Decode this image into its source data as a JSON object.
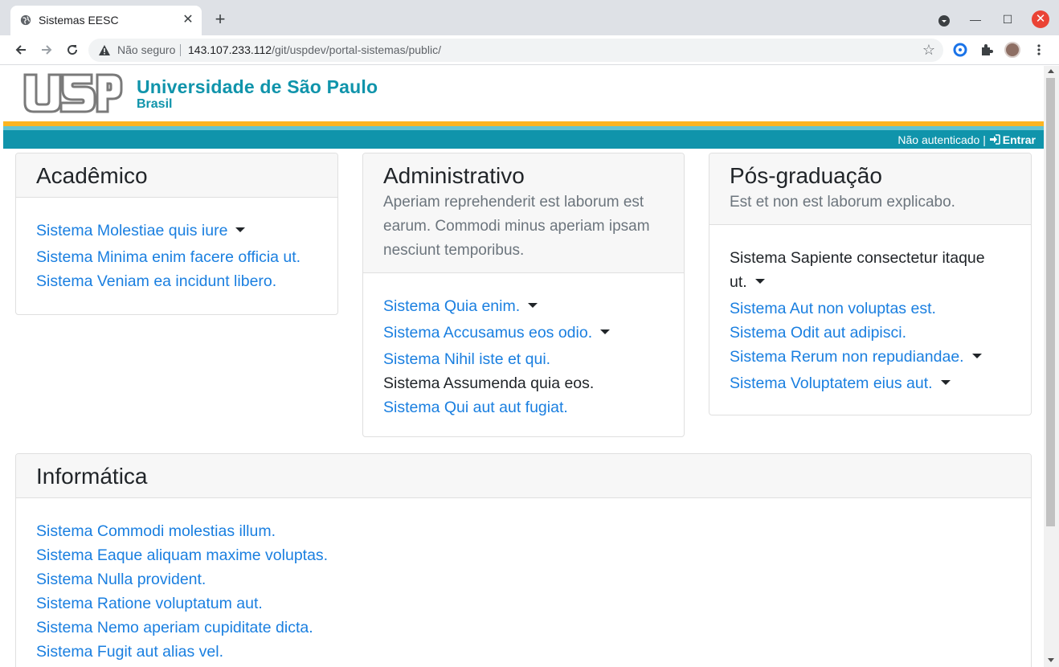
{
  "browser": {
    "tab_title": "Sistemas EESC",
    "insecure_label": "Não seguro",
    "url_host": "143.107.233.112",
    "url_path": "/git/uspdev/portal-sistemas/public/"
  },
  "header": {
    "logo_text": "USP",
    "university_name": "Universidade de São Paulo",
    "country": "Brasil",
    "auth_status": "Não autenticado |",
    "login_label": "Entrar"
  },
  "colors": {
    "brand": "#1094ab",
    "accent_yellow": "#fcb421",
    "link": "#1a7fe0"
  },
  "sections": [
    {
      "title": "Acadêmico",
      "subtitle": "",
      "items": [
        {
          "label": "Sistema Molestiae quis iure",
          "link": true,
          "dropdown": true
        },
        {
          "label": "Sistema Minima enim facere officia ut.",
          "link": true,
          "dropdown": false
        },
        {
          "label": "Sistema Veniam ea incidunt libero.",
          "link": true,
          "dropdown": false
        }
      ]
    },
    {
      "title": "Administrativo",
      "subtitle": "Aperiam reprehenderit est laborum est earum. Commodi minus aperiam ipsam nesciunt temporibus.",
      "items": [
        {
          "label": "Sistema Quia enim.",
          "link": true,
          "dropdown": true
        },
        {
          "label": "Sistema Accusamus eos odio.",
          "link": true,
          "dropdown": true
        },
        {
          "label": "Sistema Nihil iste et qui.",
          "link": true,
          "dropdown": false
        },
        {
          "label": "Sistema Assumenda quia eos.",
          "link": false,
          "dropdown": false
        },
        {
          "label": "Sistema Qui aut aut fugiat.",
          "link": true,
          "dropdown": false
        }
      ]
    },
    {
      "title": "Pós-graduação",
      "subtitle": "Est et non est laborum explicabo.",
      "items": [
        {
          "label": "Sistema Sapiente consectetur itaque ut.",
          "link": false,
          "dropdown": true
        },
        {
          "label": "Sistema Aut non voluptas est.",
          "link": true,
          "dropdown": false
        },
        {
          "label": "Sistema Odit aut adipisci.",
          "link": true,
          "dropdown": false
        },
        {
          "label": "Sistema Rerum non repudiandae.",
          "link": true,
          "dropdown": true
        },
        {
          "label": "Sistema Voluptatem eius aut.",
          "link": true,
          "dropdown": true
        }
      ]
    },
    {
      "title": "Informática",
      "subtitle": "",
      "items": [
        {
          "label": "Sistema Commodi molestias illum.",
          "link": true,
          "dropdown": false
        },
        {
          "label": "Sistema Eaque aliquam maxime voluptas.",
          "link": true,
          "dropdown": false
        },
        {
          "label": "Sistema Nulla provident.",
          "link": true,
          "dropdown": false
        },
        {
          "label": "Sistema Ratione voluptatum aut.",
          "link": true,
          "dropdown": false
        },
        {
          "label": "Sistema Nemo aperiam cupiditate dicta.",
          "link": true,
          "dropdown": false
        },
        {
          "label": "Sistema Fugit aut alias vel.",
          "link": true,
          "dropdown": false
        }
      ]
    }
  ]
}
